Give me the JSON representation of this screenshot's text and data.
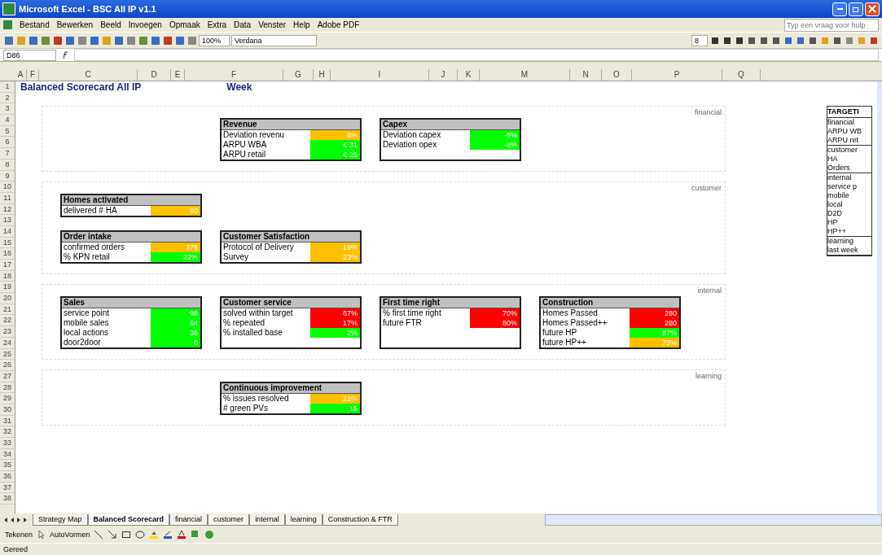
{
  "window": {
    "title": "Microsoft Excel - BSC All IP v1.1"
  },
  "menu": [
    "Bestand",
    "Bewerken",
    "Beeld",
    "Invoegen",
    "Opmaak",
    "Extra",
    "Data",
    "Venster",
    "Help",
    "Adobe PDF"
  ],
  "help_box": {
    "placeholder": "Typ een vraag voor hulp"
  },
  "toolbar": {
    "zoom": "100%",
    "font": "Verdana",
    "size": "8"
  },
  "formula_bar": {
    "cell": "D86"
  },
  "columns": [
    "A",
    "F",
    "C",
    "D",
    "E",
    "F",
    "G",
    "H",
    "I",
    "J",
    "K",
    "M",
    "N",
    "O",
    "P",
    "Q"
  ],
  "rows": [
    "1",
    "2",
    "3",
    "4",
    "5",
    "6",
    "7",
    "8",
    "9",
    "10",
    "11",
    "12",
    "13",
    "14",
    "15",
    "16",
    "17",
    "18",
    "19",
    "20",
    "21",
    "22",
    "23",
    "24",
    "25",
    "26",
    "27",
    "28",
    "29",
    "30",
    "31",
    "32",
    "33",
    "34",
    "35",
    "36",
    "37",
    "38"
  ],
  "sheet": {
    "title": "Balanced Scorecard All IP",
    "week_label": "Week",
    "sections": [
      {
        "label": "financial",
        "card_rows": [
          [
            null,
            {
              "title": "Revenue",
              "rows": [
                {
                  "label": "Deviation revenu",
                  "value": "8%",
                  "color": "#ffc000"
                },
                {
                  "label": "ARPU WBA",
                  "value": "€ 31",
                  "color": "#00ff00"
                },
                {
                  "label": "ARPU retail",
                  "value": "€ 25",
                  "color": "#00ff00"
                }
              ]
            },
            {
              "title": "Capex",
              "rows": [
                {
                  "label": "Deviation capex",
                  "value": "-6%",
                  "color": "#00ff00"
                },
                {
                  "label": "Deviation opex",
                  "value": "-8%",
                  "color": "#00ff00"
                }
              ]
            }
          ]
        ]
      },
      {
        "label": "customer",
        "card_rows": [
          [
            {
              "title": "Homes activated",
              "rows": [
                {
                  "label": "delivered # HA",
                  "value": "90",
                  "color": "#ffc000"
                }
              ]
            }
          ],
          [
            {
              "title": "Order intake",
              "rows": [
                {
                  "label": "confirmed orders",
                  "value": "376",
                  "color": "#ffc000"
                },
                {
                  "label": "% KPN retail",
                  "value": "22%",
                  "color": "#00ff00"
                }
              ]
            },
            {
              "title": "Customer Satisfaction",
              "rows": [
                {
                  "label": "Protocol of Delivery",
                  "value": "19%",
                  "color": "#ffc000"
                },
                {
                  "label": "Survey",
                  "value": "23%",
                  "color": "#ffc000"
                }
              ]
            }
          ]
        ]
      },
      {
        "label": "internal",
        "card_rows": [
          [
            {
              "title": "Sales",
              "rows": [
                {
                  "label": "service point",
                  "value": "98",
                  "color": "#00ff00"
                },
                {
                  "label": "mobile sales",
                  "value": "64",
                  "color": "#00ff00"
                },
                {
                  "label": "local actions",
                  "value": "36",
                  "color": "#00ff00"
                },
                {
                  "label": "door2door",
                  "value": "0",
                  "color": "#00ff00"
                }
              ]
            },
            {
              "title": "Customer service",
              "rows": [
                {
                  "label": "solved within target",
                  "value": "67%",
                  "color": "#ff0000"
                },
                {
                  "label": "% repeated",
                  "value": "17%",
                  "color": "#ff0000"
                },
                {
                  "label": "% installed base",
                  "value": "2%",
                  "color": "#00ff00"
                }
              ]
            },
            {
              "title": "First time right",
              "rows": [
                {
                  "label": "% first time right",
                  "value": "70%",
                  "color": "#ff0000"
                },
                {
                  "label": "future FTR",
                  "value": "80%",
                  "color": "#ff0000"
                }
              ]
            },
            {
              "title": "Construction",
              "rows": [
                {
                  "label": "Homes Passed",
                  "value": "280",
                  "color": "#ff0000"
                },
                {
                  "label": "Homes Passed++",
                  "value": "280",
                  "color": "#ff0000"
                },
                {
                  "label": "future HP",
                  "value": "87%",
                  "color": "#00ff00"
                },
                {
                  "label": "future HP++",
                  "value": "79%",
                  "color": "#ffc000"
                }
              ]
            }
          ]
        ]
      },
      {
        "label": "learning",
        "card_rows": [
          [
            null,
            {
              "title": "Continuous improvement",
              "rows": [
                {
                  "label": "% issues resolved",
                  "value": "22%",
                  "color": "#ffc000"
                },
                {
                  "label": "# green PVs",
                  "value": "15",
                  "color": "#00ff00"
                }
              ]
            }
          ]
        ]
      }
    ],
    "targets": {
      "title": "TARGETI",
      "groups": [
        [
          "financial",
          "ARPU WB",
          "ARPU ret"
        ],
        [
          "customer",
          "HA",
          "Orders"
        ],
        [
          "internal",
          "service p",
          "mobile",
          "local",
          "D2D",
          "HP",
          "HP++"
        ],
        [
          "learning",
          "last week"
        ]
      ]
    }
  },
  "sheet_tabs": [
    {
      "label": "Strategy Map",
      "selected": false
    },
    {
      "label": "Balanced Scorecard",
      "selected": true
    },
    {
      "label": "financial",
      "selected": false
    },
    {
      "label": "customer",
      "selected": false
    },
    {
      "label": "internal",
      "selected": false
    },
    {
      "label": "learning",
      "selected": false
    },
    {
      "label": "Construction & FTR",
      "selected": false
    }
  ],
  "drawing_toolbar": {
    "draw": "Tekenen",
    "autoshapes": "AutoVormen"
  },
  "status_bar": "Gereed"
}
